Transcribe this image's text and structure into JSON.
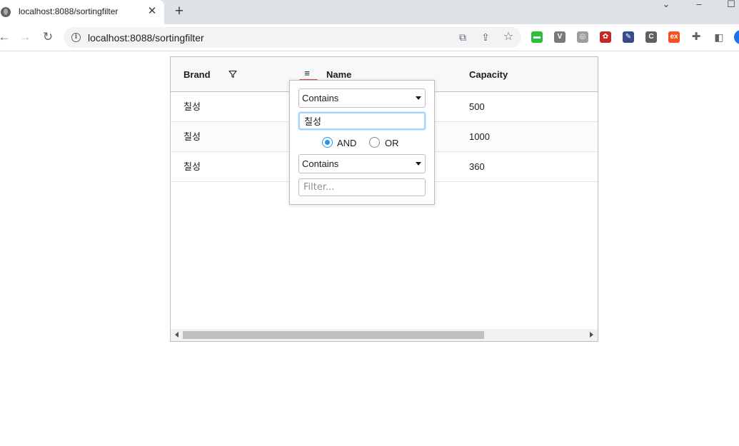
{
  "browser": {
    "tab_title": "localhost:8088/sortingfilter",
    "tab_close": "✕",
    "new_tab": "+",
    "url": "localhost:8088/sortingfilter",
    "extensions": [
      {
        "name": "screen-extension-icon",
        "glyph": "▬",
        "color": "#2bbf3a"
      },
      {
        "name": "vue-devtools-icon",
        "glyph": "V",
        "color": "#7a7a7a"
      },
      {
        "name": "circle-extension-icon",
        "glyph": "◎",
        "color": "#9e9e9e"
      },
      {
        "name": "red-extension-icon",
        "glyph": "✿",
        "color": "#c62828"
      },
      {
        "name": "feather-extension-icon",
        "glyph": "✎",
        "color": "#3a4a8a"
      },
      {
        "name": "c-extension-icon",
        "glyph": "C",
        "color": "#616161"
      },
      {
        "name": "orange-extension-icon",
        "glyph": "ex",
        "color": "#f4511e"
      }
    ]
  },
  "grid": {
    "columns": [
      {
        "key": "brand",
        "label": "Brand"
      },
      {
        "key": "name",
        "label": "Name"
      },
      {
        "key": "capacity",
        "label": "Capacity"
      }
    ],
    "rows": [
      {
        "brand": "칠성",
        "name": "",
        "capacity": "500"
      },
      {
        "brand": "칠성",
        "name": "",
        "capacity": "1000"
      },
      {
        "brand": "칠성",
        "name": "",
        "capacity": "360"
      }
    ]
  },
  "filter_popup": {
    "condition1_type": "Contains",
    "condition1_value": "칠성",
    "join_and": "AND",
    "join_or": "OR",
    "join_selected": "AND",
    "condition2_type": "Contains",
    "condition2_placeholder": "Filter..."
  }
}
